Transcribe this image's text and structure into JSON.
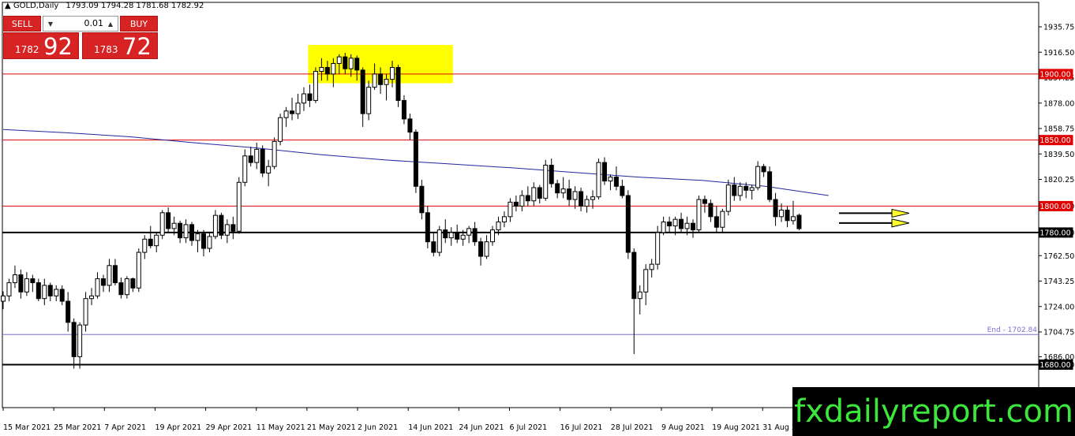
{
  "header": {
    "symbol": "GOLD,Daily",
    "ohlc": "1793.09 1794.28 1781.68 1782.92"
  },
  "trade_panel": {
    "sell_label": "SELL",
    "buy_label": "BUY",
    "lot": "0.01",
    "sell_small": "1782",
    "sell_big": "92",
    "buy_small": "1783",
    "buy_big": "72"
  },
  "brand": "fxdailyreport.com",
  "colors": {
    "bull": "#ffffff",
    "bear": "#000000",
    "resistance": "#e00000",
    "ma": "#2424a0",
    "highlight": "#ffff00",
    "fib_line": "#7b6fd0",
    "arrow": "#ffff30"
  },
  "chart_data": {
    "type": "candlestick",
    "symbol": "GOLD",
    "timeframe": "Daily",
    "ylim": [
      1671,
      1948
    ],
    "y_ticks": [
      1935.75,
      1916.5,
      1897.25,
      1878.0,
      1858.75,
      1839.5,
      1820.25,
      1800.0,
      1780.0,
      1762.5,
      1743.25,
      1724.0,
      1704.75,
      1686.0,
      1680.0
    ],
    "x_labels": [
      "15 Mar 2021",
      "25 Mar 2021",
      "7 Apr 2021",
      "19 Apr 2021",
      "29 Apr 2021",
      "11 May 2021",
      "21 May 2021",
      "2 Jun 2021",
      "14 Jun 2021",
      "24 Jun 2021",
      "6 Jul 2021",
      "16 Jul 2021",
      "28 Jul 2021",
      "9 Aug 2021",
      "19 Aug 2021",
      "31 Aug 2021"
    ],
    "candles": [
      [
        1728.0,
        1735.5,
        1722.0,
        1732.0
      ],
      [
        1732.0,
        1745.0,
        1728.0,
        1742.0
      ],
      [
        1742.0,
        1755.0,
        1738.0,
        1748.0
      ],
      [
        1748.0,
        1752.0,
        1730.0,
        1735.0
      ],
      [
        1735.0,
        1750.0,
        1732.0,
        1745.0
      ],
      [
        1745.0,
        1748.0,
        1735.0,
        1742.0
      ],
      [
        1742.0,
        1745.0,
        1728.0,
        1730.0
      ],
      [
        1730.0,
        1745.0,
        1725.0,
        1740.0
      ],
      [
        1740.0,
        1742.0,
        1728.0,
        1732.0
      ],
      [
        1732.0,
        1740.0,
        1728.0,
        1737.0
      ],
      [
        1737.0,
        1740.0,
        1725.0,
        1728.0
      ],
      [
        1728.0,
        1735.0,
        1705.0,
        1712.0
      ],
      [
        1712.0,
        1715.0,
        1677.0,
        1686.0
      ],
      [
        1686.0,
        1712.0,
        1677.0,
        1710.0
      ],
      [
        1710.0,
        1735.0,
        1705.0,
        1730.0
      ],
      [
        1730.0,
        1738.0,
        1725.0,
        1732.0
      ],
      [
        1732.0,
        1750.0,
        1730.0,
        1745.0
      ],
      [
        1745.0,
        1748.0,
        1735.0,
        1740.0
      ],
      [
        1740.0,
        1760.0,
        1735.0,
        1755.0
      ],
      [
        1755.0,
        1760.0,
        1740.0,
        1742.0
      ],
      [
        1742.0,
        1746.0,
        1730.0,
        1733.0
      ],
      [
        1733.0,
        1747.0,
        1730.0,
        1745.0
      ],
      [
        1745.0,
        1746.0,
        1735.0,
        1738.0
      ],
      [
        1738.0,
        1768.0,
        1735.0,
        1765.0
      ],
      [
        1765.0,
        1778.0,
        1760.0,
        1775.0
      ],
      [
        1775.0,
        1785.0,
        1768.0,
        1770.0
      ],
      [
        1770.0,
        1780.0,
        1765.0,
        1778.0
      ],
      [
        1778.0,
        1797.0,
        1775.0,
        1795.0
      ],
      [
        1795.0,
        1799.0,
        1780.0,
        1783.0
      ],
      [
        1783.0,
        1792.0,
        1778.0,
        1787.0
      ],
      [
        1787.0,
        1789.0,
        1772.0,
        1776.0
      ],
      [
        1776.0,
        1790.0,
        1772.0,
        1786.0
      ],
      [
        1786.0,
        1788.0,
        1770.0,
        1774.0
      ],
      [
        1774.0,
        1782.0,
        1765.0,
        1779.0
      ],
      [
        1779.0,
        1782.0,
        1762.0,
        1768.0
      ],
      [
        1768.0,
        1780.0,
        1765.0,
        1777.0
      ],
      [
        1777.0,
        1797.0,
        1775.0,
        1793.0
      ],
      [
        1793.0,
        1795.0,
        1775.0,
        1778.0
      ],
      [
        1778.0,
        1790.0,
        1772.0,
        1786.0
      ],
      [
        1786.0,
        1792.0,
        1775.0,
        1781.0
      ],
      [
        1781.0,
        1822.0,
        1779.0,
        1818.0
      ],
      [
        1818.0,
        1843.0,
        1815.0,
        1838.0
      ],
      [
        1838.0,
        1845.0,
        1830.0,
        1833.0
      ],
      [
        1833.0,
        1848.0,
        1828.0,
        1843.0
      ],
      [
        1843.0,
        1846.0,
        1822.0,
        1825.0
      ],
      [
        1825.0,
        1835.0,
        1815.0,
        1830.0
      ],
      [
        1830.0,
        1852.0,
        1828.0,
        1849.0
      ],
      [
        1849.0,
        1870.0,
        1846.0,
        1867.0
      ],
      [
        1867.0,
        1875.0,
        1860.0,
        1872.0
      ],
      [
        1872.0,
        1882.0,
        1865.0,
        1870.0
      ],
      [
        1870.0,
        1885.0,
        1866.0,
        1878.0
      ],
      [
        1878.0,
        1890.0,
        1872.0,
        1885.0
      ],
      [
        1885.0,
        1892.0,
        1875.0,
        1880.0
      ],
      [
        1880.0,
        1905.0,
        1878.0,
        1902.0
      ],
      [
        1902.0,
        1912.0,
        1895.0,
        1905.0
      ],
      [
        1905.0,
        1910.0,
        1895.0,
        1900.0
      ],
      [
        1900.0,
        1912.0,
        1890.0,
        1908.0
      ],
      [
        1908.0,
        1915.0,
        1900.0,
        1913.0
      ],
      [
        1913.0,
        1916.0,
        1900.0,
        1904.0
      ],
      [
        1904.0,
        1915.0,
        1898.0,
        1912.0
      ],
      [
        1912.0,
        1914.0,
        1895.0,
        1903.0
      ],
      [
        1903.0,
        1905.0,
        1860.0,
        1870.0
      ],
      [
        1870.0,
        1895.0,
        1865.0,
        1890.0
      ],
      [
        1890.0,
        1908.0,
        1888.0,
        1900.0
      ],
      [
        1900.0,
        1905.0,
        1885.0,
        1892.0
      ],
      [
        1892.0,
        1900.0,
        1880.0,
        1896.0
      ],
      [
        1896.0,
        1910.0,
        1890.0,
        1905.0
      ],
      [
        1905.0,
        1907.0,
        1875.0,
        1880.0
      ],
      [
        1880.0,
        1884.0,
        1862.0,
        1866.0
      ],
      [
        1866.0,
        1870.0,
        1850.0,
        1856.0
      ],
      [
        1856.0,
        1858.0,
        1810.0,
        1815.0
      ],
      [
        1815.0,
        1820.0,
        1790.0,
        1795.0
      ],
      [
        1795.0,
        1800.0,
        1768.0,
        1773.0
      ],
      [
        1773.0,
        1780.0,
        1762.0,
        1765.0
      ],
      [
        1765.0,
        1785.0,
        1762.0,
        1782.0
      ],
      [
        1782.0,
        1790.0,
        1772.0,
        1776.0
      ],
      [
        1776.0,
        1784.0,
        1770.0,
        1780.0
      ],
      [
        1780.0,
        1786.0,
        1772.0,
        1775.0
      ],
      [
        1775.0,
        1782.0,
        1770.0,
        1778.0
      ],
      [
        1778.0,
        1785.0,
        1772.0,
        1783.0
      ],
      [
        1783.0,
        1788.0,
        1770.0,
        1773.0
      ],
      [
        1773.0,
        1776.0,
        1755.0,
        1762.0
      ],
      [
        1762.0,
        1778.0,
        1760.0,
        1773.0
      ],
      [
        1773.0,
        1785.0,
        1770.0,
        1782.0
      ],
      [
        1782.0,
        1792.0,
        1778.0,
        1788.0
      ],
      [
        1788.0,
        1796.0,
        1784.0,
        1792.0
      ],
      [
        1792.0,
        1806.0,
        1788.0,
        1803.0
      ],
      [
        1803.0,
        1808.0,
        1796.0,
        1800.0
      ],
      [
        1800.0,
        1812.0,
        1796.0,
        1808.0
      ],
      [
        1808.0,
        1815.0,
        1800.0,
        1804.0
      ],
      [
        1804.0,
        1818.0,
        1800.0,
        1814.0
      ],
      [
        1814.0,
        1816.0,
        1802.0,
        1806.0
      ],
      [
        1806.0,
        1835.0,
        1804.0,
        1831.0
      ],
      [
        1831.0,
        1836.0,
        1814.0,
        1817.0
      ],
      [
        1817.0,
        1820.0,
        1806.0,
        1810.0
      ],
      [
        1810.0,
        1822.0,
        1806.0,
        1813.0
      ],
      [
        1813.0,
        1820.0,
        1800.0,
        1805.0
      ],
      [
        1805.0,
        1815.0,
        1798.0,
        1811.0
      ],
      [
        1811.0,
        1814.0,
        1796.0,
        1800.0
      ],
      [
        1800.0,
        1808.0,
        1795.0,
        1805.0
      ],
      [
        1805.0,
        1812.0,
        1798.0,
        1807.0
      ],
      [
        1807.0,
        1836.0,
        1805.0,
        1833.0
      ],
      [
        1833.0,
        1837.0,
        1816.0,
        1819.0
      ],
      [
        1819.0,
        1824.0,
        1812.0,
        1822.0
      ],
      [
        1822.0,
        1830.0,
        1812.0,
        1815.0
      ],
      [
        1815.0,
        1820.0,
        1806.0,
        1808.0
      ],
      [
        1808.0,
        1812.0,
        1760.0,
        1765.0
      ],
      [
        1765.0,
        1768.0,
        1688.0,
        1730.0
      ],
      [
        1730.0,
        1740.0,
        1718.0,
        1735.0
      ],
      [
        1735.0,
        1756.0,
        1725.0,
        1752.0
      ],
      [
        1752.0,
        1760.0,
        1746.0,
        1756.0
      ],
      [
        1756.0,
        1785.0,
        1752.0,
        1780.0
      ],
      [
        1780.0,
        1792.0,
        1778.0,
        1788.0
      ],
      [
        1788.0,
        1792.0,
        1780.0,
        1785.0
      ],
      [
        1785.0,
        1792.0,
        1778.0,
        1790.0
      ],
      [
        1790.0,
        1795.0,
        1780.0,
        1783.0
      ],
      [
        1783.0,
        1792.0,
        1778.0,
        1787.0
      ],
      [
        1787.0,
        1790.0,
        1776.0,
        1782.0
      ],
      [
        1782.0,
        1808.0,
        1780.0,
        1805.0
      ],
      [
        1805.0,
        1808.0,
        1795.0,
        1802.0
      ],
      [
        1802.0,
        1805.0,
        1788.0,
        1792.0
      ],
      [
        1792.0,
        1800.0,
        1780.0,
        1784.0
      ],
      [
        1784.0,
        1798.0,
        1780.0,
        1796.0
      ],
      [
        1796.0,
        1820.0,
        1793.0,
        1816.0
      ],
      [
        1816.0,
        1822.0,
        1804.0,
        1808.0
      ],
      [
        1808.0,
        1818.0,
        1804.0,
        1815.0
      ],
      [
        1815.0,
        1818.0,
        1806.0,
        1812.0
      ],
      [
        1812.0,
        1816.0,
        1805.0,
        1814.0
      ],
      [
        1814.0,
        1834.0,
        1812.0,
        1830.0
      ],
      [
        1830.0,
        1832.0,
        1822.0,
        1826.0
      ],
      [
        1826.0,
        1830.0,
        1803.0,
        1805.0
      ],
      [
        1805.0,
        1810.0,
        1785.0,
        1792.0
      ],
      [
        1792.0,
        1802.0,
        1788.0,
        1797.0
      ],
      [
        1797.0,
        1800.0,
        1784.0,
        1789.0
      ],
      [
        1789.0,
        1804.0,
        1786.0,
        1792.0
      ],
      [
        1793.09,
        1794.28,
        1781.68,
        1782.92
      ]
    ],
    "moving_average": {
      "values": [
        1858.0,
        1855.5,
        1852.5,
        1848.0,
        1844.0,
        1839.0,
        1835.0,
        1832.0,
        1829.0,
        1825.5,
        1822.0,
        1819.5,
        1815.0,
        1808.0
      ],
      "end_index": 140
    },
    "levels": [
      {
        "label": "1900.00",
        "value": 1900.0,
        "kind": "resistance"
      },
      {
        "label": "1850.00",
        "value": 1850.0,
        "kind": "resistance"
      },
      {
        "label": "1800.00",
        "value": 1800.0,
        "kind": "resistance"
      },
      {
        "label": "1780.00",
        "value": 1780.0,
        "kind": "support"
      },
      {
        "label": "1680.00",
        "value": 1680.0,
        "kind": "support"
      }
    ],
    "fib_line": {
      "label": "End - 1702.84",
      "value": 1702.84
    },
    "highlight_box": {
      "from_index": 52,
      "to_index": 76,
      "y_low": 1893.0,
      "y_high": 1922.0
    },
    "arrows": [
      {
        "value": 1800.0
      },
      {
        "value": 1789.0
      }
    ]
  }
}
